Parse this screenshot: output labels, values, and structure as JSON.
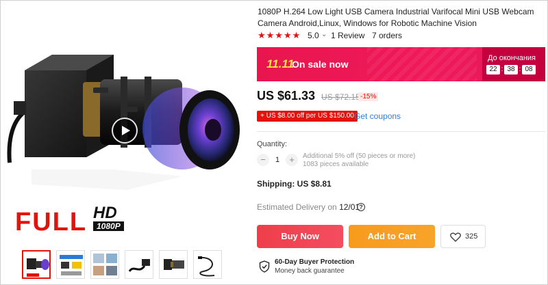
{
  "product": {
    "title": "1080P H.264 Low Light USB Camera Industrial Varifocal Mini USB Webcam Camera Android,Linux, Windows for Robotic Machine Vision",
    "rating": {
      "stars": "★★★★★",
      "value": "5.0",
      "chevron": "⌄",
      "reviews": "1 Review",
      "orders": "7 orders"
    },
    "image_badge": {
      "full": "FULL",
      "hd": "HD",
      "resolution": "1080P"
    }
  },
  "sale": {
    "logo": "11.11",
    "text": "On sale now",
    "countdown_label": "До окончания",
    "hours": "22",
    "minutes": "38",
    "seconds": "08",
    "separator": ":"
  },
  "price": {
    "current": "US $61.33",
    "original": "US $72.15",
    "discount": "-15%"
  },
  "coupon": {
    "badge": "+ US $8.00 off per US $150.00",
    "link": "Get coupons"
  },
  "quantity": {
    "label": "Quantity:",
    "minus": "−",
    "value": "1",
    "plus": "+",
    "note_line1": "Additional 5% off (50 pieces or more)",
    "note_line2": "1083 pieces available"
  },
  "shipping": {
    "text": "Shipping: US $8.81"
  },
  "delivery": {
    "label": "Estimated Delivery on",
    "date": "12/01",
    "help": "?"
  },
  "actions": {
    "buy_now": "Buy Now",
    "add_to_cart": "Add to Cart",
    "wishlist_count": "325"
  },
  "protection": {
    "title": "60-Day Buyer Protection",
    "subtitle": "Money back guarantee"
  },
  "icons": {
    "play": "play-icon",
    "heart": "heart-icon",
    "shield": "shield-check-icon",
    "help": "help-circle-icon"
  },
  "colors": {
    "accent_red": "#e3120b",
    "sale_pink": "#f0195a",
    "buy_now": "#ee3e4a",
    "add_to_cart": "#f79b1c",
    "link_blue": "#2e7ed8"
  }
}
